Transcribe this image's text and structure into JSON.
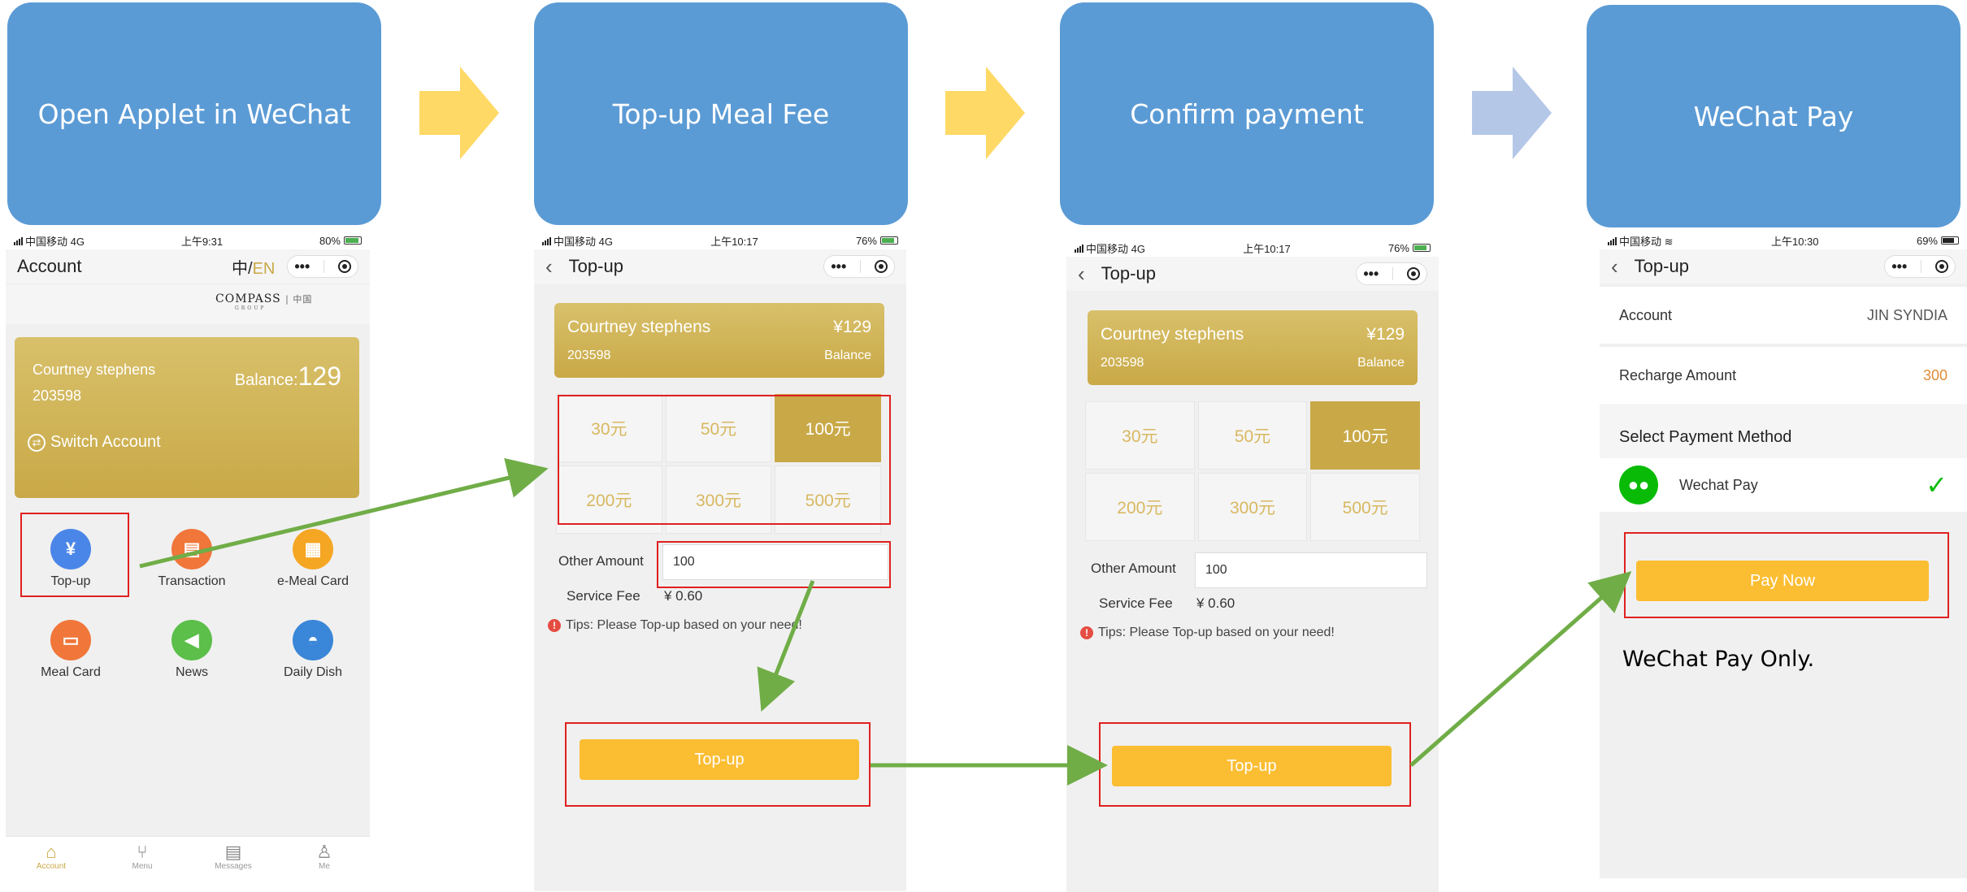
{
  "steps": [
    {
      "title": "Open Applet in WeChat"
    },
    {
      "title": "Top-up Meal Fee"
    },
    {
      "title": "Confirm payment"
    },
    {
      "title": "WeChat Pay"
    }
  ],
  "colors": {
    "step_box": "#5b9bd5",
    "arrow_yellow": "#ffd966",
    "arrow_blue": "#b4c7e7",
    "gold": "#c9a947",
    "button_yellow": "#fbbd32",
    "annotation_red": "#e02020",
    "flow_green": "#70ad47"
  },
  "phone1": {
    "status": {
      "carrier": "中国移动 4G",
      "time": "上午9:31",
      "battery": "80%"
    },
    "nav_title": "Account",
    "lang_zh": "中/",
    "lang_en": "EN",
    "logo_text": "COMPASS",
    "logo_sub": "| 中国",
    "logo_group": "GROUP",
    "card": {
      "name": "Courtney stephens",
      "id": "203598",
      "balance_label": "Balance:",
      "balance": "129",
      "switch_label": "Switch Account"
    },
    "menu": [
      {
        "label": "Top-up",
        "icon": "top-up-icon"
      },
      {
        "label": "Transaction",
        "icon": "transaction-icon"
      },
      {
        "label": "e-Meal Card",
        "icon": "qr-code-icon"
      },
      {
        "label": "Meal Card",
        "icon": "card-icon"
      },
      {
        "label": "News",
        "icon": "megaphone-icon"
      },
      {
        "label": "Daily Dish",
        "icon": "dish-icon"
      }
    ],
    "tabs": [
      {
        "label": "Account",
        "icon": "home-icon"
      },
      {
        "label": "Menu",
        "icon": "cutlery-icon"
      },
      {
        "label": "Messages",
        "icon": "clipboard-icon"
      },
      {
        "label": "Me",
        "icon": "person-icon"
      }
    ]
  },
  "phone2": {
    "status": {
      "carrier": "中国移动 4G",
      "time": "上午10:17",
      "battery": "76%"
    },
    "nav_title": "Top-up",
    "card": {
      "name": "Courtney stephens",
      "balance": "¥129",
      "id": "203598",
      "balance_label": "Balance"
    },
    "amounts": [
      "30元",
      "50元",
      "100元",
      "200元",
      "300元",
      "500元"
    ],
    "selected_amount": "100元",
    "other_amount_label": "Other Amount",
    "other_amount_value": "100",
    "service_fee_label": "Service Fee",
    "service_fee_value": "¥ 0.60",
    "tip": "Tips: Please Top-up based on your need!",
    "button": "Top-up"
  },
  "phone3": {
    "status": {
      "carrier": "中国移动 4G",
      "time": "上午10:17",
      "battery": "76%"
    },
    "nav_title": "Top-up",
    "card": {
      "name": "Courtney stephens",
      "balance": "¥129",
      "id": "203598",
      "balance_label": "Balance"
    },
    "amounts": [
      "30元",
      "50元",
      "100元",
      "200元",
      "300元",
      "500元"
    ],
    "selected_amount": "100元",
    "other_amount_label": "Other Amount",
    "other_amount_value": "100",
    "service_fee_label": "Service Fee",
    "service_fee_value": "¥ 0.60",
    "tip": "Tips: Please Top-up based on your need!",
    "button": "Top-up"
  },
  "phone4": {
    "status": {
      "carrier": "中国移动",
      "time": "上午10:30",
      "battery": "69%"
    },
    "nav_title": "Top-up",
    "account_label": "Account",
    "account_value": "JIN SYNDIA",
    "recharge_label": "Recharge Amount",
    "recharge_value": "300",
    "select_method": "Select Payment Method",
    "method": "Wechat Pay",
    "button": "Pay Now",
    "caption": "WeChat Pay Only."
  }
}
